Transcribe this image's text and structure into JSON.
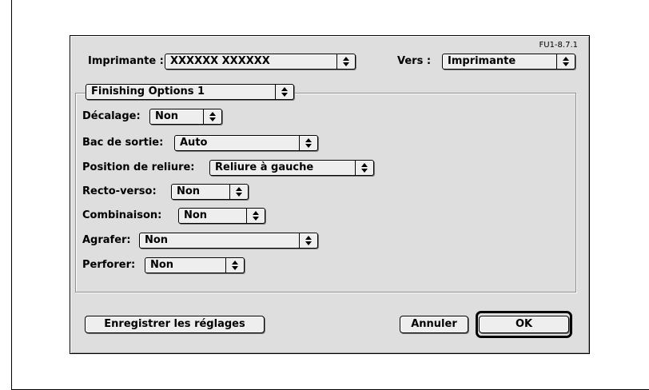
{
  "version_label": "FU1-8.7.1",
  "header": {
    "printer_label": "Imprimante :",
    "printer_value": "XXXXXX XXXXXX",
    "dest_label": "Vers :",
    "dest_value": "Imprimante"
  },
  "panel_select": {
    "value": "Finishing Options 1"
  },
  "options": [
    {
      "label": "Décalage:",
      "value": "Non"
    },
    {
      "label": "Bac de sortie:",
      "value": "Auto"
    },
    {
      "label": "Position de reliure:",
      "value": "Reliure à gauche"
    },
    {
      "label": "Recto-verso:",
      "value": "Non"
    },
    {
      "label": "Combinaison:",
      "value": "Non"
    },
    {
      "label": "Agrafer:",
      "value": "Non"
    },
    {
      "label": "Perforer:",
      "value": "Non"
    }
  ],
  "buttons": {
    "save": "Enregistrer les réglages",
    "cancel": "Annuler",
    "ok": "OK"
  },
  "icons": {
    "popup_arrow": "up-down-arrows-icon"
  }
}
